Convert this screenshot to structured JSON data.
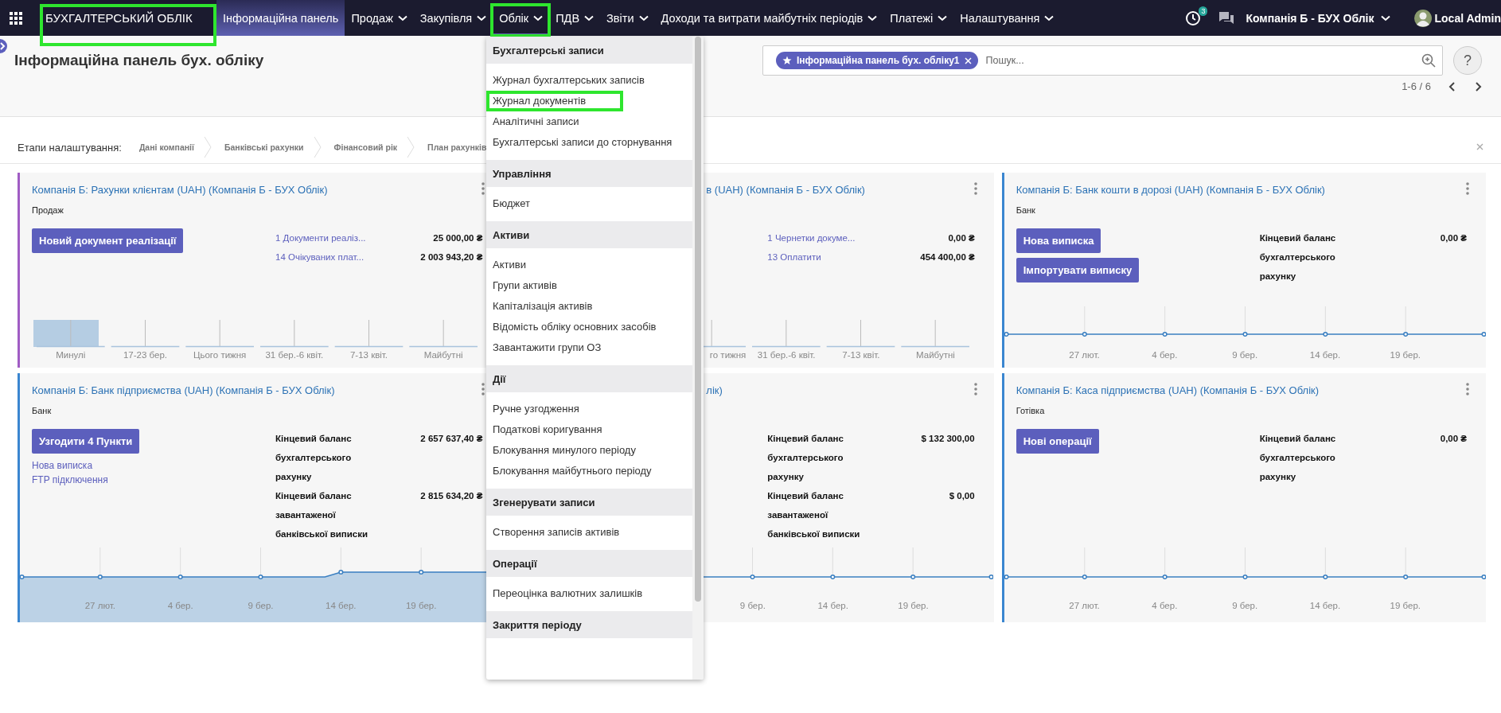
{
  "navbar": {
    "brand": {
      "label": "БУХГАЛТЕРСЬКИЙ ОБЛІК",
      "highlighted": true
    },
    "menu": [
      {
        "label": "Інформаційна панель",
        "selected": true,
        "has_menu": false,
        "expanded": false,
        "highlighted": false
      },
      {
        "label": "Продаж",
        "selected": false,
        "has_menu": true,
        "expanded": false,
        "highlighted": false
      },
      {
        "label": "Закупівля",
        "selected": false,
        "has_menu": true,
        "expanded": false,
        "highlighted": false
      },
      {
        "label": "Облік",
        "selected": false,
        "has_menu": true,
        "expanded": true,
        "highlighted": true
      },
      {
        "label": "ПДВ",
        "selected": false,
        "has_menu": true,
        "expanded": false,
        "highlighted": false
      },
      {
        "label": "Звіти",
        "selected": false,
        "has_menu": true,
        "expanded": false,
        "highlighted": false
      },
      {
        "label": "Доходи та витрати майбутніх періодів",
        "selected": false,
        "has_menu": true,
        "expanded": false,
        "highlighted": false
      },
      {
        "label": "Платежі",
        "selected": false,
        "has_menu": true,
        "expanded": false,
        "highlighted": false
      },
      {
        "label": "Налаштування",
        "selected": false,
        "has_menu": true,
        "expanded": false,
        "highlighted": false
      }
    ],
    "activity_count": "3",
    "company": "Компанія Б - БУХ Облік",
    "user": "Local Admin"
  },
  "page_title": "Інформаційна панель бух. обліку",
  "search": {
    "facet": "Інформаційна панель бух. обліку1",
    "placeholder": "Пошук..."
  },
  "help": "?",
  "pager": "1-6 / 6",
  "setup": {
    "label": "Етапи налаштування:",
    "steps": [
      "Дані компанії",
      "Банківські рахунки",
      "Фінансовий рік",
      "План рахунків"
    ]
  },
  "open_menu": {
    "sections": [
      {
        "title": "Бухгалтерські записи",
        "items": [
          {
            "label": "Журнал бухгалтерських записів",
            "highlighted": false
          },
          {
            "label": "Журнал документів",
            "highlighted": true
          },
          {
            "label": "Аналітичні записи",
            "highlighted": false
          },
          {
            "label": "Бухгалтерські записи до сторнування",
            "highlighted": false
          }
        ]
      },
      {
        "title": "Управління",
        "items": [
          {
            "label": "Бюджет",
            "highlighted": false
          }
        ]
      },
      {
        "title": "Активи",
        "items": [
          {
            "label": "Активи",
            "highlighted": false
          },
          {
            "label": "Групи активів",
            "highlighted": false
          },
          {
            "label": "Капіталізація активів",
            "highlighted": false
          },
          {
            "label": "Відомість обліку основних засобів",
            "highlighted": false
          },
          {
            "label": "Завантажити групи ОЗ",
            "highlighted": false
          }
        ]
      },
      {
        "title": "Дії",
        "items": [
          {
            "label": "Ручне узгодження",
            "highlighted": false
          },
          {
            "label": "Податкові коригування",
            "highlighted": false
          },
          {
            "label": "Блокування минулого періоду",
            "highlighted": false
          },
          {
            "label": "Блокування майбутнього періоду",
            "highlighted": false
          }
        ]
      },
      {
        "title": "Згенерувати записи",
        "items": [
          {
            "label": "Створення записів активів",
            "highlighted": false
          }
        ]
      },
      {
        "title": "Операції",
        "items": [
          {
            "label": "Переоцінка валютних залишків",
            "highlighted": false
          }
        ]
      },
      {
        "title": "Закриття періоду"
      }
    ]
  },
  "cards": [
    {
      "title": "Компанія Б: Рахунки клієнтам (UAH) (Компанія Б - БУХ Облік)",
      "subtitle": "Продаж",
      "color": "#a05cc4",
      "buttons": [
        "Новий документ реалізації"
      ],
      "stats": [
        {
          "kind": "link",
          "label": "1 Документи реаліз...",
          "value": "25 000,00 ₴"
        },
        {
          "kind": "link",
          "label": "14 Очікуваних плат...",
          "value": "2 003 943,20 ₴"
        }
      ],
      "chart": {
        "kind": "bars",
        "labels": [
          "Минулі",
          "17-23 бер.",
          "Цього тижня",
          "31 бер.-6 квіт.",
          "7-13 квіт.",
          "Майбутні"
        ]
      }
    },
    {
      "title": "в (UAH) (Компанія Б - БУХ Облік)",
      "stats": [
        {
          "kind": "link",
          "label": "1 Чернетки докуме...",
          "value": "0,00 ₴"
        },
        {
          "kind": "link",
          "label": "13 Оплатити",
          "value": "454 400,00 ₴"
        }
      ],
      "chart": {
        "kind": "bars",
        "labels": [
          "го тижня",
          "31 бер.-6 квіт.",
          "7-13 квіт.",
          "Майбутні"
        ]
      }
    },
    {
      "title": "Компанія Б: Банк кошти в дорозі (UAH) (Компанія Б - БУХ Облік)",
      "subtitle": "Банк",
      "color": "#3a86d0",
      "buttons": [
        "Нова виписка",
        "Імпортувати виписку"
      ],
      "stats": [
        {
          "kind": "balance",
          "label": "Кінцевий баланс бухгалтерського рахунку",
          "value": "0,00 ₴"
        }
      ],
      "chart": {
        "kind": "line",
        "labels": [
          "27 лют.",
          "4 бер.",
          "9 бер.",
          "14 бер.",
          "19 бер."
        ]
      }
    },
    {
      "title": "Компанія Б: Банк підприємства (UAH) (Компанія Б - БУХ Облік)",
      "subtitle": "Банк",
      "color": "#3a86d0",
      "buttons": [
        "Узгодити 4 Пункти"
      ],
      "links": [
        "Нова виписка",
        "FTP підключення"
      ],
      "stats": [
        {
          "kind": "balance",
          "label": "Кінцевий баланс бухгалтерського рахунку",
          "value": "2 657 637,40 ₴"
        },
        {
          "kind": "balance",
          "label": "Кінцевий баланс завантаженої банківської виписки",
          "value": "2 815 634,20 ₴"
        }
      ],
      "chart": {
        "kind": "area",
        "labels": [
          "27 лют.",
          "4 бер.",
          "9 бер.",
          "14 бер.",
          "19 бер."
        ]
      }
    },
    {
      "title": "лік)",
      "stats": [
        {
          "kind": "balance",
          "label": "Кінцевий баланс бухгалтерського рахунку",
          "value": "$ 132 300,00"
        },
        {
          "kind": "balance",
          "label": "Кінцевий баланс завантаженої банківської виписки",
          "value": "$ 0,00"
        }
      ],
      "chart": {
        "kind": "line",
        "labels": [
          "9 бер.",
          "14 бер.",
          "19 бер."
        ]
      }
    },
    {
      "title": "Компанія Б: Каса підприємства (UAH) (Компанія Б - БУХ Облік)",
      "subtitle": "Готівка",
      "color": "#3a86d0",
      "buttons": [
        "Нові операції"
      ],
      "stats": [
        {
          "kind": "balance",
          "label": "Кінцевий баланс бухгалтерського рахунку",
          "value": "0,00 ₴"
        }
      ],
      "chart": {
        "kind": "line",
        "labels": [
          "27 лют.",
          "4 бер.",
          "9 бер.",
          "14 бер.",
          "19 бер."
        ]
      }
    }
  ]
}
